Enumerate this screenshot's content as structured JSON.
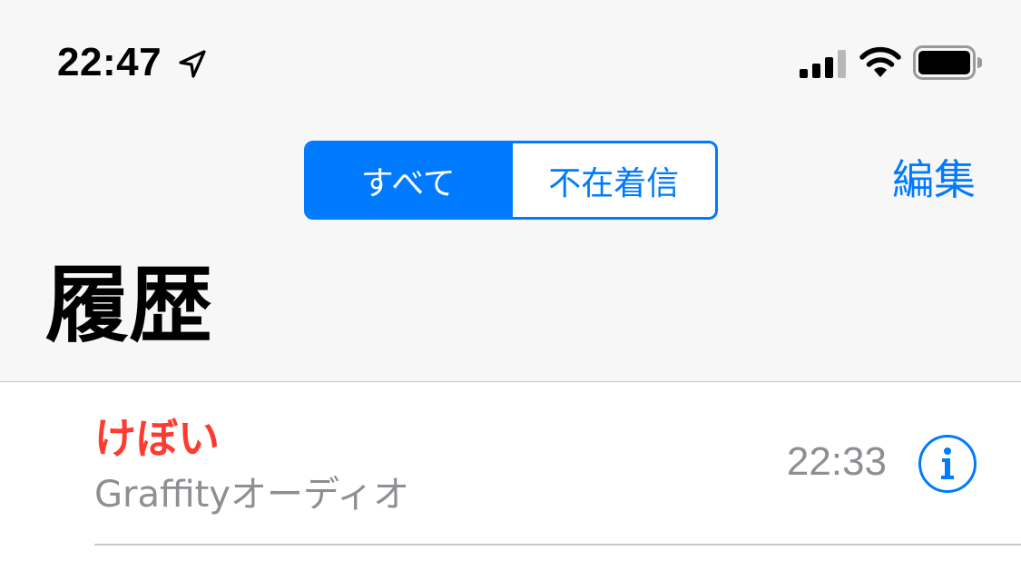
{
  "status_bar": {
    "time": "22:47",
    "location_icon": "location-arrow-icon",
    "signal_icon": "cellular-signal-icon",
    "wifi_icon": "wifi-icon",
    "battery_icon": "battery-icon"
  },
  "nav": {
    "segments": [
      {
        "label": "すべて",
        "selected": true
      },
      {
        "label": "不在着信",
        "selected": false
      }
    ],
    "edit_label": "編集"
  },
  "page_title": "履歴",
  "calls": [
    {
      "name": "けぼい",
      "type": "Graffityオーディオ",
      "time": "22:33",
      "missed": true,
      "info_icon": "info-icon"
    }
  ],
  "colors": {
    "accent": "#007aff",
    "missed": "#ff3b30",
    "secondary_text": "#8e8e93",
    "header_bg": "#f7f7f7",
    "separator": "#c8c7cc"
  }
}
